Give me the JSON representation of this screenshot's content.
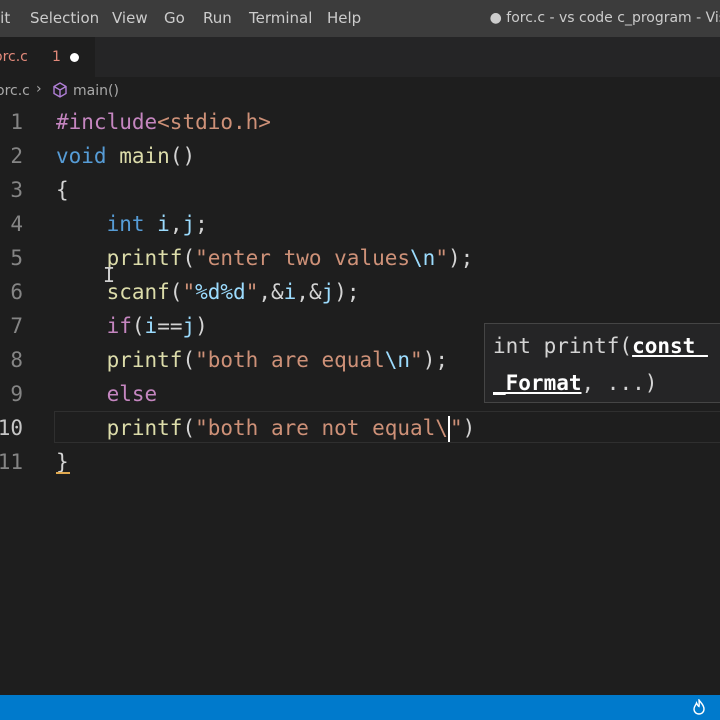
{
  "menu": {
    "items": [
      {
        "label": "lit"
      },
      {
        "label": "Selection"
      },
      {
        "label": "View"
      },
      {
        "label": "Go"
      },
      {
        "label": "Run"
      },
      {
        "label": "Terminal"
      },
      {
        "label": "Help"
      }
    ],
    "window_title": "● forc.c - vs code c_program - Visi"
  },
  "tab": {
    "label": "orc.c",
    "problem_count": "1",
    "modified_icon": "dot-icon"
  },
  "breadcrumb": {
    "file": "orc.c",
    "separator": "›",
    "symbol_icon": "cube-icon",
    "symbol": "main()"
  },
  "editor": {
    "current_line": "10",
    "lines": [
      {
        "num": "1"
      },
      {
        "num": "2"
      },
      {
        "num": "3"
      },
      {
        "num": "4"
      },
      {
        "num": "5"
      },
      {
        "num": "6"
      },
      {
        "num": "7"
      },
      {
        "num": "8"
      },
      {
        "num": "9"
      },
      {
        "num": "10"
      },
      {
        "num": "11"
      }
    ],
    "tokens": {
      "l1_a": "#include",
      "l1_b": "<stdio.h>",
      "l2_a": "void",
      "l2_b": "main",
      "l2_c": "()",
      "l3": "{",
      "l4_a": "int",
      "l4_b": "i",
      "l4_c": ",",
      "l4_d": "j",
      "l4_e": ";",
      "l5_a": "printf",
      "l5_b": "(",
      "l5_c": "\"enter two values",
      "l5_d": "\\n",
      "l5_e": "\"",
      "l5_f": ");",
      "l6_a": "scanf",
      "l6_b": "(",
      "l6_c": "\"",
      "l6_d": "%d%d",
      "l6_e": "\"",
      "l6_f": ",&",
      "l6_g": "i",
      "l6_h": ",&",
      "l6_i": "j",
      "l6_j": ");",
      "l7_a": "if",
      "l7_b": "(",
      "l7_c": "i",
      "l7_d": "==",
      "l7_e": "j",
      "l7_f": ")",
      "l8_a": "printf",
      "l8_b": "(",
      "l8_c": "\"both are equal",
      "l8_d": "\\n",
      "l8_e": "\"",
      "l8_f": ");",
      "l9": "else",
      "l10_a": "printf",
      "l10_b": "(",
      "l10_c": "\"both are not equal\\",
      "l10_d": "\"",
      "l10_e": ")",
      "l11": "}"
    }
  },
  "signature_help": {
    "line1_prefix": "int printf(",
    "active_param_part1": "const ",
    "active_param_part2": "_Format",
    "rest": ", ...)"
  },
  "statusbar": {
    "icon": "flame-icon"
  }
}
